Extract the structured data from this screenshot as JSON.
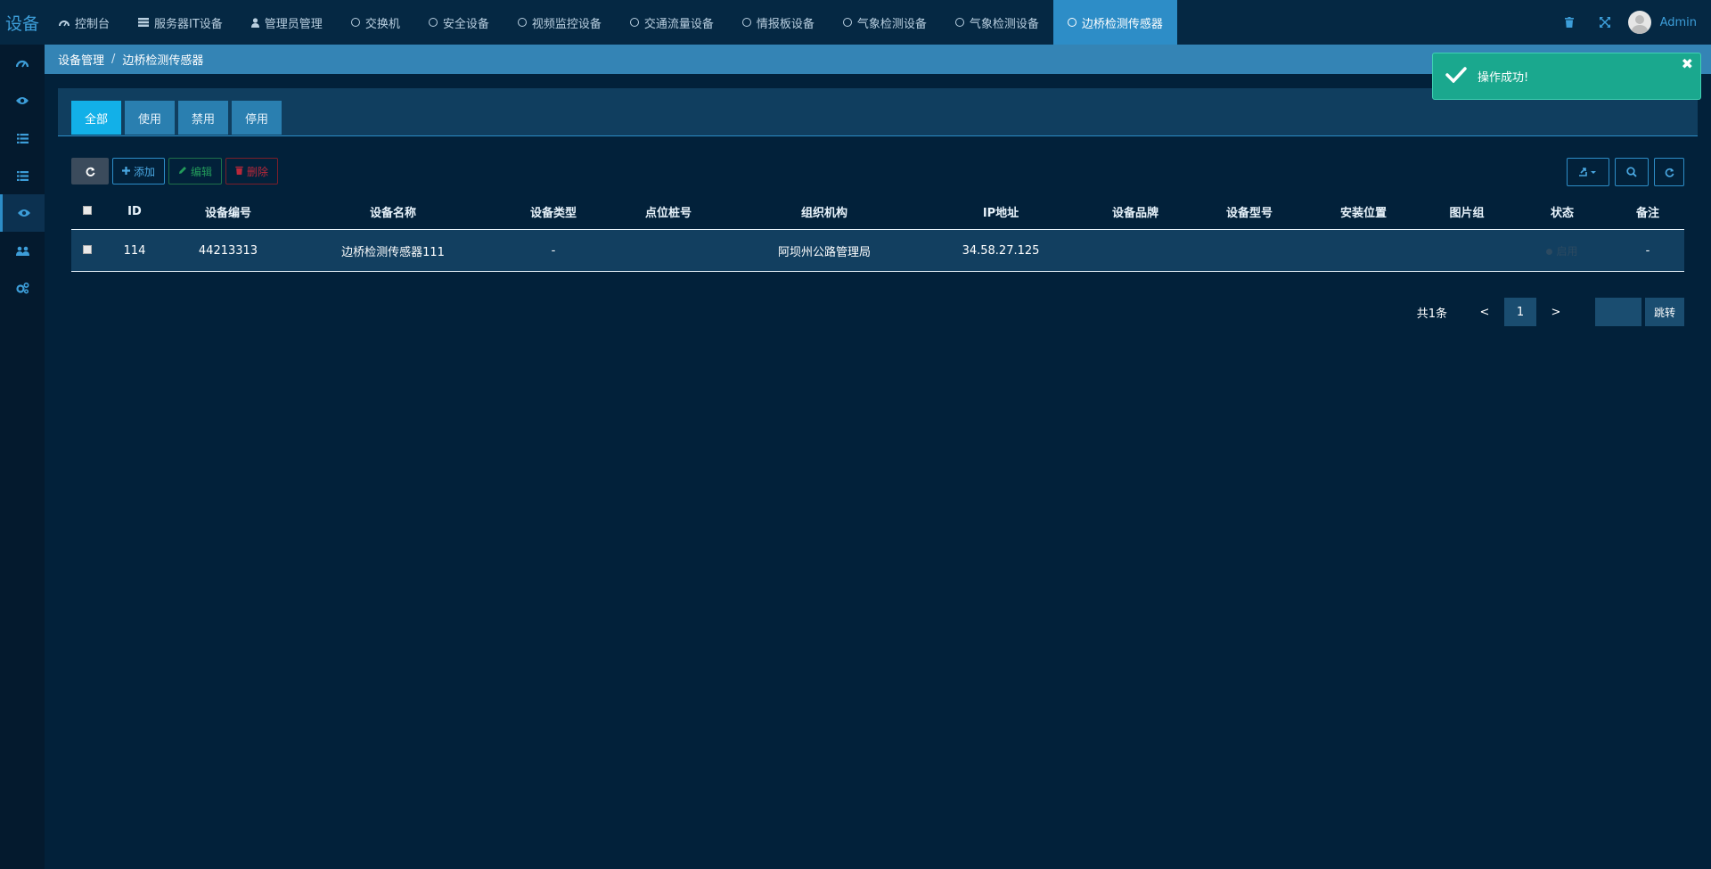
{
  "brand": "设备",
  "nav": {
    "tabs": [
      {
        "label": "控制台",
        "icon": "dashboard-icon"
      },
      {
        "label": "服务器IT设备",
        "icon": "server-icon"
      },
      {
        "label": "管理员管理",
        "icon": "user-icon"
      },
      {
        "label": "交换机",
        "icon": "circle-icon"
      },
      {
        "label": "安全设备",
        "icon": "circle-icon"
      },
      {
        "label": "视频监控设备",
        "icon": "circle-icon"
      },
      {
        "label": "交通流量设备",
        "icon": "circle-icon"
      },
      {
        "label": "情报板设备",
        "icon": "circle-icon"
      },
      {
        "label": "气象检测设备",
        "icon": "circle-icon"
      },
      {
        "label": "气象检测设备",
        "icon": "circle-icon"
      },
      {
        "label": "边桥检测传感器",
        "icon": "circle-icon"
      }
    ],
    "active_index": 10
  },
  "topright": {
    "user_name": "Admin"
  },
  "breadcrumb": {
    "root": "设备管理",
    "current": "边桥检测传感器"
  },
  "subtabs": [
    "全部",
    "使用",
    "禁用",
    "停用"
  ],
  "toolbar": {
    "add_label": "添加",
    "edit_label": "编辑",
    "delete_label": "删除"
  },
  "table": {
    "columns": [
      "ID",
      "设备编号",
      "设备名称",
      "设备类型",
      "点位桩号",
      "组织机构",
      "IP地址",
      "设备品牌",
      "设备型号",
      "安装位置",
      "图片组",
      "状态",
      "备注"
    ],
    "rows": [
      {
        "id": "114",
        "code": "44213313",
        "name": "边桥检测传感器111",
        "type": "-",
        "stake": "",
        "org": "阿坝州公路管理局",
        "ip": "34.58.27.125",
        "brand": "",
        "model": "",
        "location": "",
        "images": "",
        "status": "启用",
        "remark": "-"
      }
    ]
  },
  "pagination": {
    "total_label": "共1条",
    "prev": "<",
    "current": "1",
    "next": ">",
    "go_label": "跳转"
  },
  "toast": {
    "message": "操作成功!"
  },
  "colors": {
    "accent": "#2d8dc7",
    "active_subtab": "#12b0e8",
    "toast": "#1aa88e"
  }
}
